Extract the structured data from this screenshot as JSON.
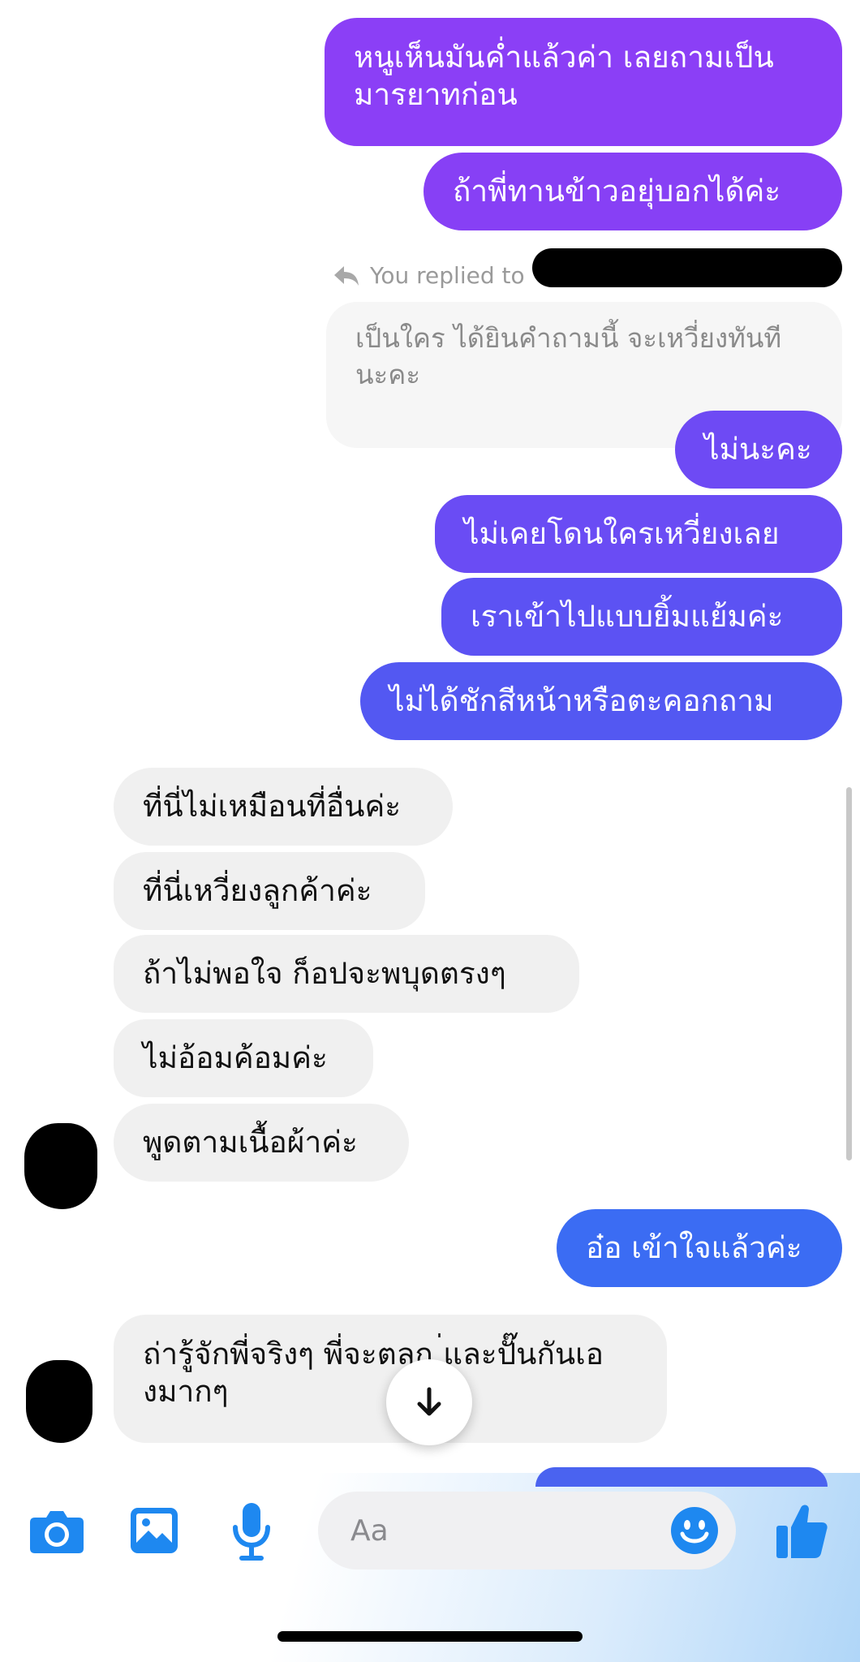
{
  "messages": {
    "out_1": "หนูเห็นมันค่ำแล้วค่า เลยถามเป็นมารยาทก่อน",
    "out_2": "ถ้าพี่ทานข้าวอยุ่บอกได้ค่ะ",
    "reply_label": "You replied to",
    "quoted": "เป็นใคร ได้ยินคำถามนี้ จะเหวี่ยงทันทีนะคะ",
    "out_3": "ไม่นะคะ",
    "out_4": "ไม่เคยโดนใครเหวี่ยงเลย",
    "out_5": "เราเข้าไปแบบยิ้มแย้มค่ะ",
    "out_6": "ไม่ได้ชักสีหน้าหรือตะคอกถาม",
    "in_1": "ที่นี่ไม่เหมือนที่อื่นค่ะ",
    "in_2": "ที่นี่เหวี่ยงลูกค้าค่ะ",
    "in_3": "ถ้าไม่พอใจ ก็อปจะพบุดตรงๆ",
    "in_4": "ไม่อ้อมค้อมค่ะ",
    "in_5": "พูดตามเนื้อผ้าค่ะ",
    "out_7": "อ๋อ เข้าใจแล้วค่ะ",
    "in_6": "ถ่ารู้จักพี่จริงๆ พี่จะตลก ่และปั๊นกันเองมากๆ"
  },
  "composer": {
    "placeholder": "Aa"
  },
  "icons": {
    "camera": "camera-icon",
    "gallery": "gallery-icon",
    "mic": "microphone-icon",
    "emoji": "emoji-icon",
    "like": "thumbs-up-icon",
    "scroll_down": "arrow-down-icon",
    "reply": "reply-arrow-icon"
  },
  "colors": {
    "accent_blue": "#1e88f0",
    "bubble_purple_top": "#8b3ff6",
    "bubble_blue_bottom": "#3b6cf3",
    "incoming_bubble": "#f0f0f0"
  }
}
